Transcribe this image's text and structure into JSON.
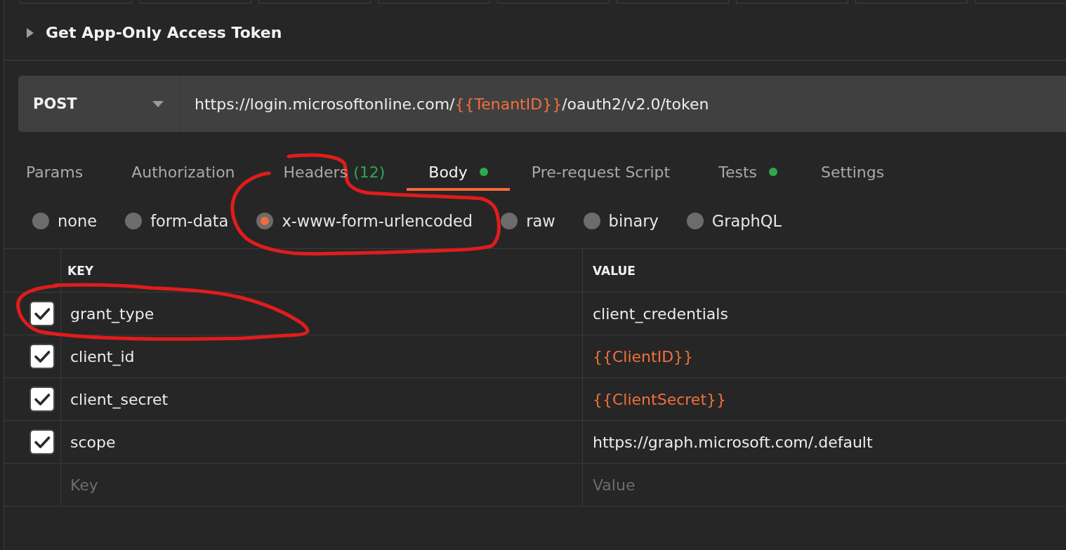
{
  "request": {
    "title": "Get App-Only Access Token",
    "expanded": false
  },
  "method": "POST",
  "url": [
    {
      "kind": "text",
      "text": "https://login.microsoftonline.com/"
    },
    {
      "kind": "variable",
      "text": "{{TenantID}}"
    },
    {
      "kind": "text",
      "text": "/oauth2/v2.0/token"
    }
  ],
  "tabs": [
    {
      "label": "Params",
      "selected": false,
      "has_content": false
    },
    {
      "label": "Authorization",
      "selected": false,
      "has_content": false
    },
    {
      "label": "Headers",
      "count": "(12)",
      "selected": false,
      "has_content": false
    },
    {
      "label": "Body",
      "selected": true,
      "has_content": true
    },
    {
      "label": "Pre-request Script",
      "selected": false,
      "has_content": false
    },
    {
      "label": "Tests",
      "selected": false,
      "has_content": true
    },
    {
      "label": "Settings",
      "selected": false,
      "has_content": false
    }
  ],
  "body_types": [
    {
      "label": "none",
      "selected": false,
      "circled": false
    },
    {
      "label": "form-data",
      "selected": false,
      "circled": false
    },
    {
      "label": "x-www-form-urlencoded",
      "selected": true,
      "circled": true
    },
    {
      "label": "raw",
      "selected": false,
      "circled": false
    },
    {
      "label": "binary",
      "selected": false,
      "circled": false
    },
    {
      "label": "GraphQL",
      "selected": false,
      "circled": false
    }
  ],
  "table": {
    "columns": [
      "KEY",
      "VALUE"
    ],
    "rows": [
      {
        "checked": true,
        "key": "grant_type",
        "value": "client_credentials",
        "kind": "text",
        "circled": true
      },
      {
        "checked": true,
        "key": "client_id",
        "value": "{{ClientID}}",
        "kind": "variable",
        "circled": false
      },
      {
        "checked": true,
        "key": "client_secret",
        "value": "{{ClientSecret}}",
        "kind": "variable",
        "circled": false
      },
      {
        "checked": true,
        "key": "scope",
        "value": "https://graph.microsoft.com/.default",
        "kind": "text",
        "circled": false
      }
    ],
    "new_row": {
      "key_placeholder": "Key",
      "value_placeholder": "Value"
    }
  }
}
